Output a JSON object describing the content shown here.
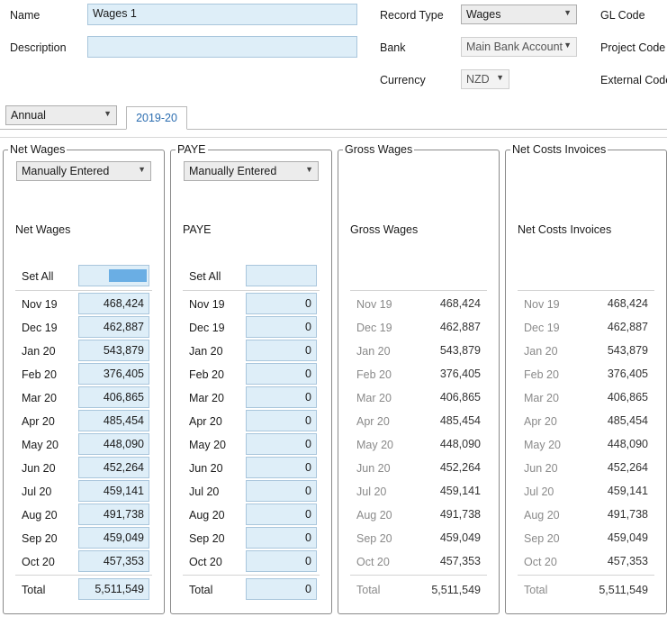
{
  "form": {
    "name_label": "Name",
    "name_value": "Wages 1",
    "description_label": "Description",
    "description_value": "",
    "record_type_label": "Record Type",
    "record_type_value": "Wages",
    "bank_label": "Bank",
    "bank_value": "Main Bank Account",
    "currency_label": "Currency",
    "currency_value": "NZD",
    "gl_code_label": "GL Code",
    "project_code_label": "Project Code",
    "external_code_label": "External Code"
  },
  "period_select": "Annual",
  "tab": "2019-20",
  "months": [
    "Nov 19",
    "Dec 19",
    "Jan 20",
    "Feb 20",
    "Mar 20",
    "Apr 20",
    "May 20",
    "Jun 20",
    "Jul 20",
    "Aug 20",
    "Sep 20",
    "Oct 20"
  ],
  "set_all_label": "Set All",
  "total_label": "Total",
  "panels": {
    "net_wages": {
      "title": "Net Wages",
      "mode": "Manually Entered",
      "heading": "Net Wages",
      "set_all_fill": 1,
      "values": [
        "468,424",
        "462,887",
        "543,879",
        "376,405",
        "406,865",
        "485,454",
        "448,090",
        "452,264",
        "459,141",
        "491,738",
        "459,049",
        "457,353"
      ],
      "total": "5,511,549"
    },
    "paye": {
      "title": "PAYE",
      "mode": "Manually Entered",
      "heading": "PAYE",
      "values": [
        "0",
        "0",
        "0",
        "0",
        "0",
        "0",
        "0",
        "0",
        "0",
        "0",
        "0",
        "0"
      ],
      "total": "0"
    },
    "gross_wages": {
      "title": "Gross Wages",
      "heading": "Gross Wages",
      "values": [
        "468,424",
        "462,887",
        "543,879",
        "376,405",
        "406,865",
        "485,454",
        "448,090",
        "452,264",
        "459,141",
        "491,738",
        "459,049",
        "457,353"
      ],
      "total": "5,511,549"
    },
    "net_costs_invoices": {
      "title": "Net Costs Invoices",
      "heading": "Net Costs Invoices",
      "values": [
        "468,424",
        "462,887",
        "543,879",
        "376,405",
        "406,865",
        "485,454",
        "448,090",
        "452,264",
        "459,141",
        "491,738",
        "459,049",
        "457,353"
      ],
      "total": "5,511,549"
    }
  },
  "icons": {
    "dropdown": "chevron-down-icon"
  }
}
